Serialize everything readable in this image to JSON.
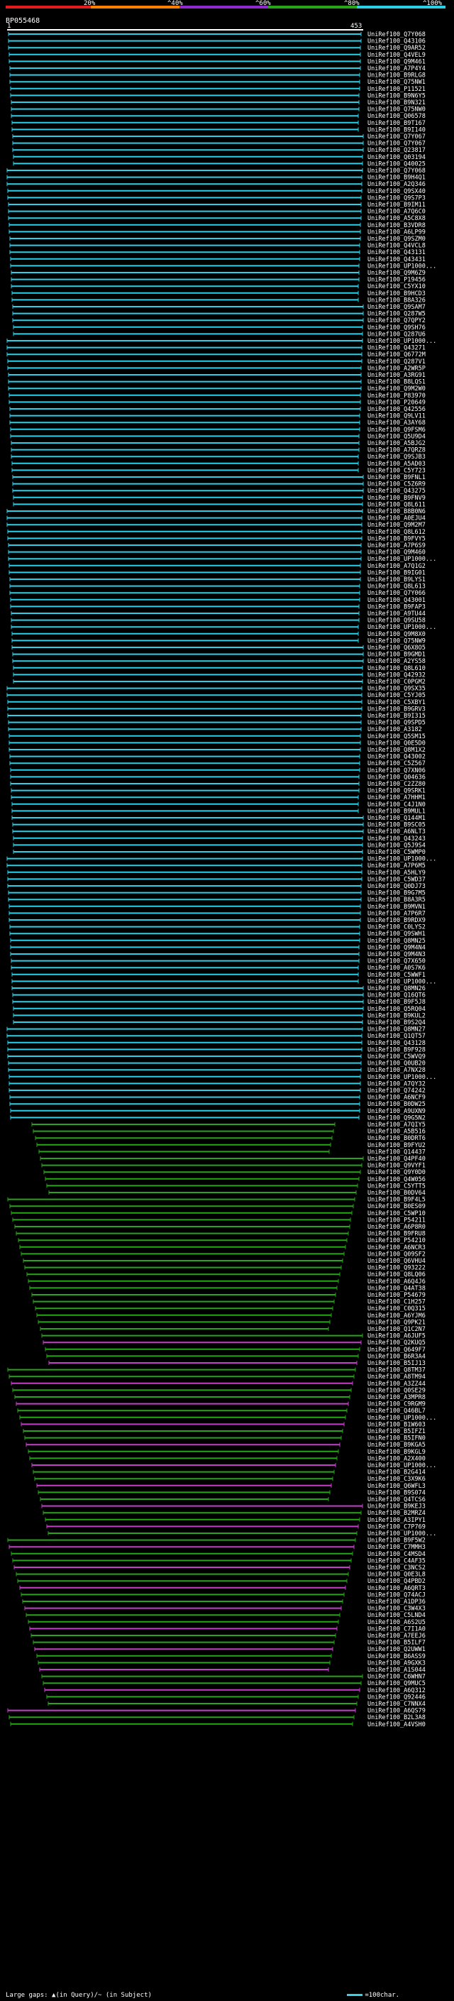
{
  "query": {
    "id": "BP055468",
    "start": "1",
    "end": "453"
  },
  "scale": {
    "ticks": [
      "20%",
      "^40%",
      "^60%",
      "^80%",
      "^100%"
    ],
    "colors": [
      "#e41a1c",
      "#ff7f00",
      "#8f2ad0",
      "#27a418",
      "#2ad0e6"
    ]
  },
  "footer": {
    "legend": "Large gaps: ▲(in Query)/~ (in Subject)",
    "scale_label": "=100char."
  },
  "hits": [
    "UniRef100_Q7Y068",
    "UniRef100_Q43106",
    "UniRef100_Q9AR52",
    "UniRef100_Q4VEL9",
    "UniRef100_Q9M461",
    "UniRef100_A7P4Y4",
    "UniRef100_B9RLG8",
    "UniRef100_Q75NW1",
    "UniRef100_P11521",
    "UniRef100_B9N6Y5",
    "UniRef100_B9N321",
    "UniRef100_Q75NW0",
    "UniRef100_Q06578",
    "UniRef100_B9T167",
    "UniRef100_B9I140",
    "UniRef100_Q7Y067",
    "UniRef100_Q7Y067",
    "UniRef100_Q23817",
    "UniRef100_Q03194",
    "UniRef100_Q40025",
    "UniRef100_Q7Y068",
    "UniRef100_B9H4Q1",
    "UniRef100_A2Q346",
    "UniRef100_Q9SX40",
    "UniRef100_Q9S7P3",
    "UniRef100_B9IM11",
    "UniRef100_A7Q6C0",
    "UniRef100_A5C8X8",
    "UniRef100_B3VDR8",
    "UniRef100_A6LP99",
    "UniRef100_Q9SZM0",
    "UniRef100_Q4VCL8",
    "UniRef100_Q43131",
    "UniRef100_Q43431",
    "UniRef100_UP1000...",
    "UniRef100_Q9M6Z9",
    "UniRef100_P19456",
    "UniRef100_C5YX10",
    "UniRef100_B9HCD3",
    "UniRef100_B8A326",
    "UniRef100_Q9SAM7",
    "UniRef100_Q287W5",
    "UniRef100_Q7QPY2",
    "UniRef100_Q9SH76",
    "UniRef100_Q287U6",
    "UniRef100_UP1000...",
    "UniRef100_Q43271",
    "UniRef100_Q6772M",
    "UniRef100_Q287V1",
    "UniRef100_A2WR5P",
    "UniRef100_A3RG91",
    "UniRef100_B8LQS1",
    "UniRef100_Q9M2W0",
    "UniRef100_P83970",
    "UniRef100_P20649",
    "UniRef100_Q42556",
    "UniRef100_Q9LV11",
    "UniRef100_A3AY68",
    "UniRef100_Q9FSM6",
    "UniRef100_Q5U9D4",
    "UniRef100_A5BJG2",
    "UniRef100_A7QRZ8",
    "UniRef100_Q9SJB3",
    "UniRef100_A5AD03",
    "UniRef100_C5Y723",
    "UniRef100_B9FNL1",
    "UniRef100_C5Z6R9",
    "UniRef100_Q43275",
    "UniRef100_B9FNV9",
    "UniRef100_Q8L611",
    "UniRef100_B8B0N6",
    "UniRef100_A0EJU4",
    "UniRef100_Q9M2M7",
    "UniRef100_Q8L612",
    "UniRef100_B9FVY5",
    "UniRef100_A7P6S9",
    "UniRef100_Q9M460",
    "UniRef100_UP1000...",
    "UniRef100_A7Q1G2",
    "UniRef100_B9IG01",
    "UniRef100_B9LYS1",
    "UniRef100_Q8L613",
    "UniRef100_Q7Y066",
    "UniRef100_Q43001",
    "UniRef100_B9FAP3",
    "UniRef100_A9TU44",
    "UniRef100_Q9SU58",
    "UniRef100_UP1000...",
    "UniRef100_Q9M8X0",
    "UniRef100_Q75NW9",
    "UniRef100_Q6X8O5",
    "UniRef100_B9GMD1",
    "UniRef100_A2YS58",
    "UniRef100_Q8L610",
    "UniRef100_Q42932",
    "UniRef100_C0PGM2",
    "UniRef100_Q9SX35",
    "UniRef100_C5YJ05",
    "UniRef100_C5XBY1",
    "UniRef100_B9GRV3",
    "UniRef100_B9I315",
    "UniRef100_Q9SPD5",
    "UniRef100_A3182",
    "UniRef100_Q5SM15",
    "UniRef100_Q0E5D0",
    "UniRef100_Q8M1X2",
    "UniRef100_Q43002",
    "UniRef100_C5Z567",
    "UniRef100_Q7XN06",
    "UniRef100_Q04636",
    "UniRef100_C2ZZ80",
    "UniRef100_Q9SRK1",
    "UniRef100_A7HHM1",
    "UniRef100_C4J1N0",
    "UniRef100_B9MUL1",
    "UniRef100_Q144M1",
    "UniRef100_B9SC05",
    "UniRef100_A6NLT3",
    "UniRef100_Q43243",
    "UniRef100_Q5J9S4",
    "UniRef100_C5WMP0",
    "UniRef100_UP1000...",
    "UniRef100_A7P6M5",
    "UniRef100_A5HLY9",
    "UniRef100_C5WD37",
    "UniRef100_Q0DJ73",
    "UniRef100_B9G7M5",
    "UniRef100_B8A3R5",
    "UniRef100_B9MVN1",
    "UniRef100_A7P6R7",
    "UniRef100_B9RDX9",
    "UniRef100_C0LYS2",
    "UniRef100_Q9SWH1",
    "UniRef100_Q8MN25",
    "UniRef100_Q9M4N4",
    "UniRef100_Q9M4N3",
    "UniRef100_Q7X650",
    "UniRef100_A0S7K6",
    "UniRef100_C5WWF1",
    "UniRef100_UP1000...",
    "UniRef100_Q8MN26",
    "UniRef100_Q16QT6",
    "UniRef100_B9F5J8",
    "UniRef100_Q5RQ04",
    "UniRef100_B9KUL2",
    "UniRef100_B9S2Q4",
    "UniRef100_Q8MN27",
    "UniRef100_Q1QT57",
    "UniRef100_Q43128",
    "UniRef100_B9F928",
    "UniRef100_C5WVQ9",
    "UniRef100_Q0UB20",
    "UniRef100_A7NX28",
    "UniRef100_UP1000...",
    "UniRef100_A7QY32",
    "UniRef100_Q74242",
    "UniRef100_A6NCF9",
    "UniRef100_B0DW25",
    "UniRef100_A9UXN9",
    "UniRef100_Q9G5N2",
    "UniRef100_A7QIY5",
    "UniRef100_A5B516",
    "UniRef100_B0DRT6",
    "UniRef100_B9FYU2",
    "UniRef100_Q14437",
    "UniRef100_Q4PF40",
    "UniRef100_Q9VYF1",
    "UniRef100_Q9Y0D0",
    "UniRef100_Q4W056",
    "UniRef100_C5YTT5",
    "UniRef100_B0DV64",
    "UniRef100_B9F4L5",
    "UniRef100_B0ES09",
    "UniRef100_C5WP10",
    "UniRef100_P54211",
    "UniRef100_A6P8R0",
    "UniRef100_B9FRU8",
    "UniRef100_P54210",
    "UniRef100_A6NCR3",
    "UniRef100_Q09SF2",
    "UniRef100_Q6VHU4",
    "UniRef100_Q93222",
    "UniRef100_Q8LQ06",
    "UniRef100_A6Q4J6",
    "UniRef100_Q4AT38",
    "UniRef100_P54679",
    "UniRef100_C1H257",
    "UniRef100_C0Q315",
    "UniRef100_A6YJM6",
    "UniRef100_Q9PK21",
    "UniRef100_Q1C2N7",
    "UniRef100_A6JUF5",
    "UniRef100_Q2KUQ5",
    "UniRef100_Q649F7",
    "UniRef100_B6R3A4",
    "UniRef100_B5IJ13",
    "UniRef100_Q8TM37",
    "UniRef100_A8TM94",
    "UniRef100_A3ZZ44",
    "UniRef100_Q0SE29",
    "UniRef100_A3MPR8",
    "UniRef100_C9RGM9",
    "UniRef100_Q46BL7",
    "UniRef100_UP1000...",
    "UniRef100_B1W603",
    "UniRef100_B5IFZ1",
    "UniRef100_B5IFN0",
    "UniRef100_B9KGA5",
    "UniRef100_B9KGL9",
    "UniRef100_A2X400",
    "UniRef100_UP1000...",
    "UniRef100_B2G414",
    "UniRef100_C3X9K6",
    "UniRef100_Q6WFL3",
    "UniRef100_B9S074",
    "UniRef100_Q4TCS6",
    "UniRef100_B9KEJ3",
    "UniRef100_B2MRZ4",
    "UniRef100_A3IPY1",
    "UniRef100_C7P769",
    "UniRef100_UP1000...",
    "UniRef100_B9F5W2",
    "UniRef100_C7MMH3",
    "UniRef100_C4MSD4",
    "UniRef100_C4AF35",
    "UniRef100_C3NCS2",
    "UniRef100_Q0E3L8",
    "UniRef100_Q4PBD2",
    "UniRef100_A6QRT3",
    "UniRef100_Q74ACJ",
    "UniRef100_A1DP36",
    "UniRef100_C3W4X3",
    "UniRef100_C5LND4",
    "UniRef100_A6S2U5",
    "UniRef100_C7I1A0",
    "UniRef100_A7EEJ6",
    "UniRef100_B5ILF7",
    "UniRef100_Q2UWW1",
    "UniRef100_B6ASS9",
    "UniRef100_A9GXK3",
    "UniRef100_A1S044",
    "UniRef100_C6WHN7",
    "UniRef100_Q9MUC5",
    "UniRef100_A6Q312",
    "UniRef100_Q92446",
    "UniRef100_C7NNX4",
    "UniRef100_A6QS79",
    "UniRef100_B2L3A8",
    "UniRef100_A4VSH0"
  ]
}
